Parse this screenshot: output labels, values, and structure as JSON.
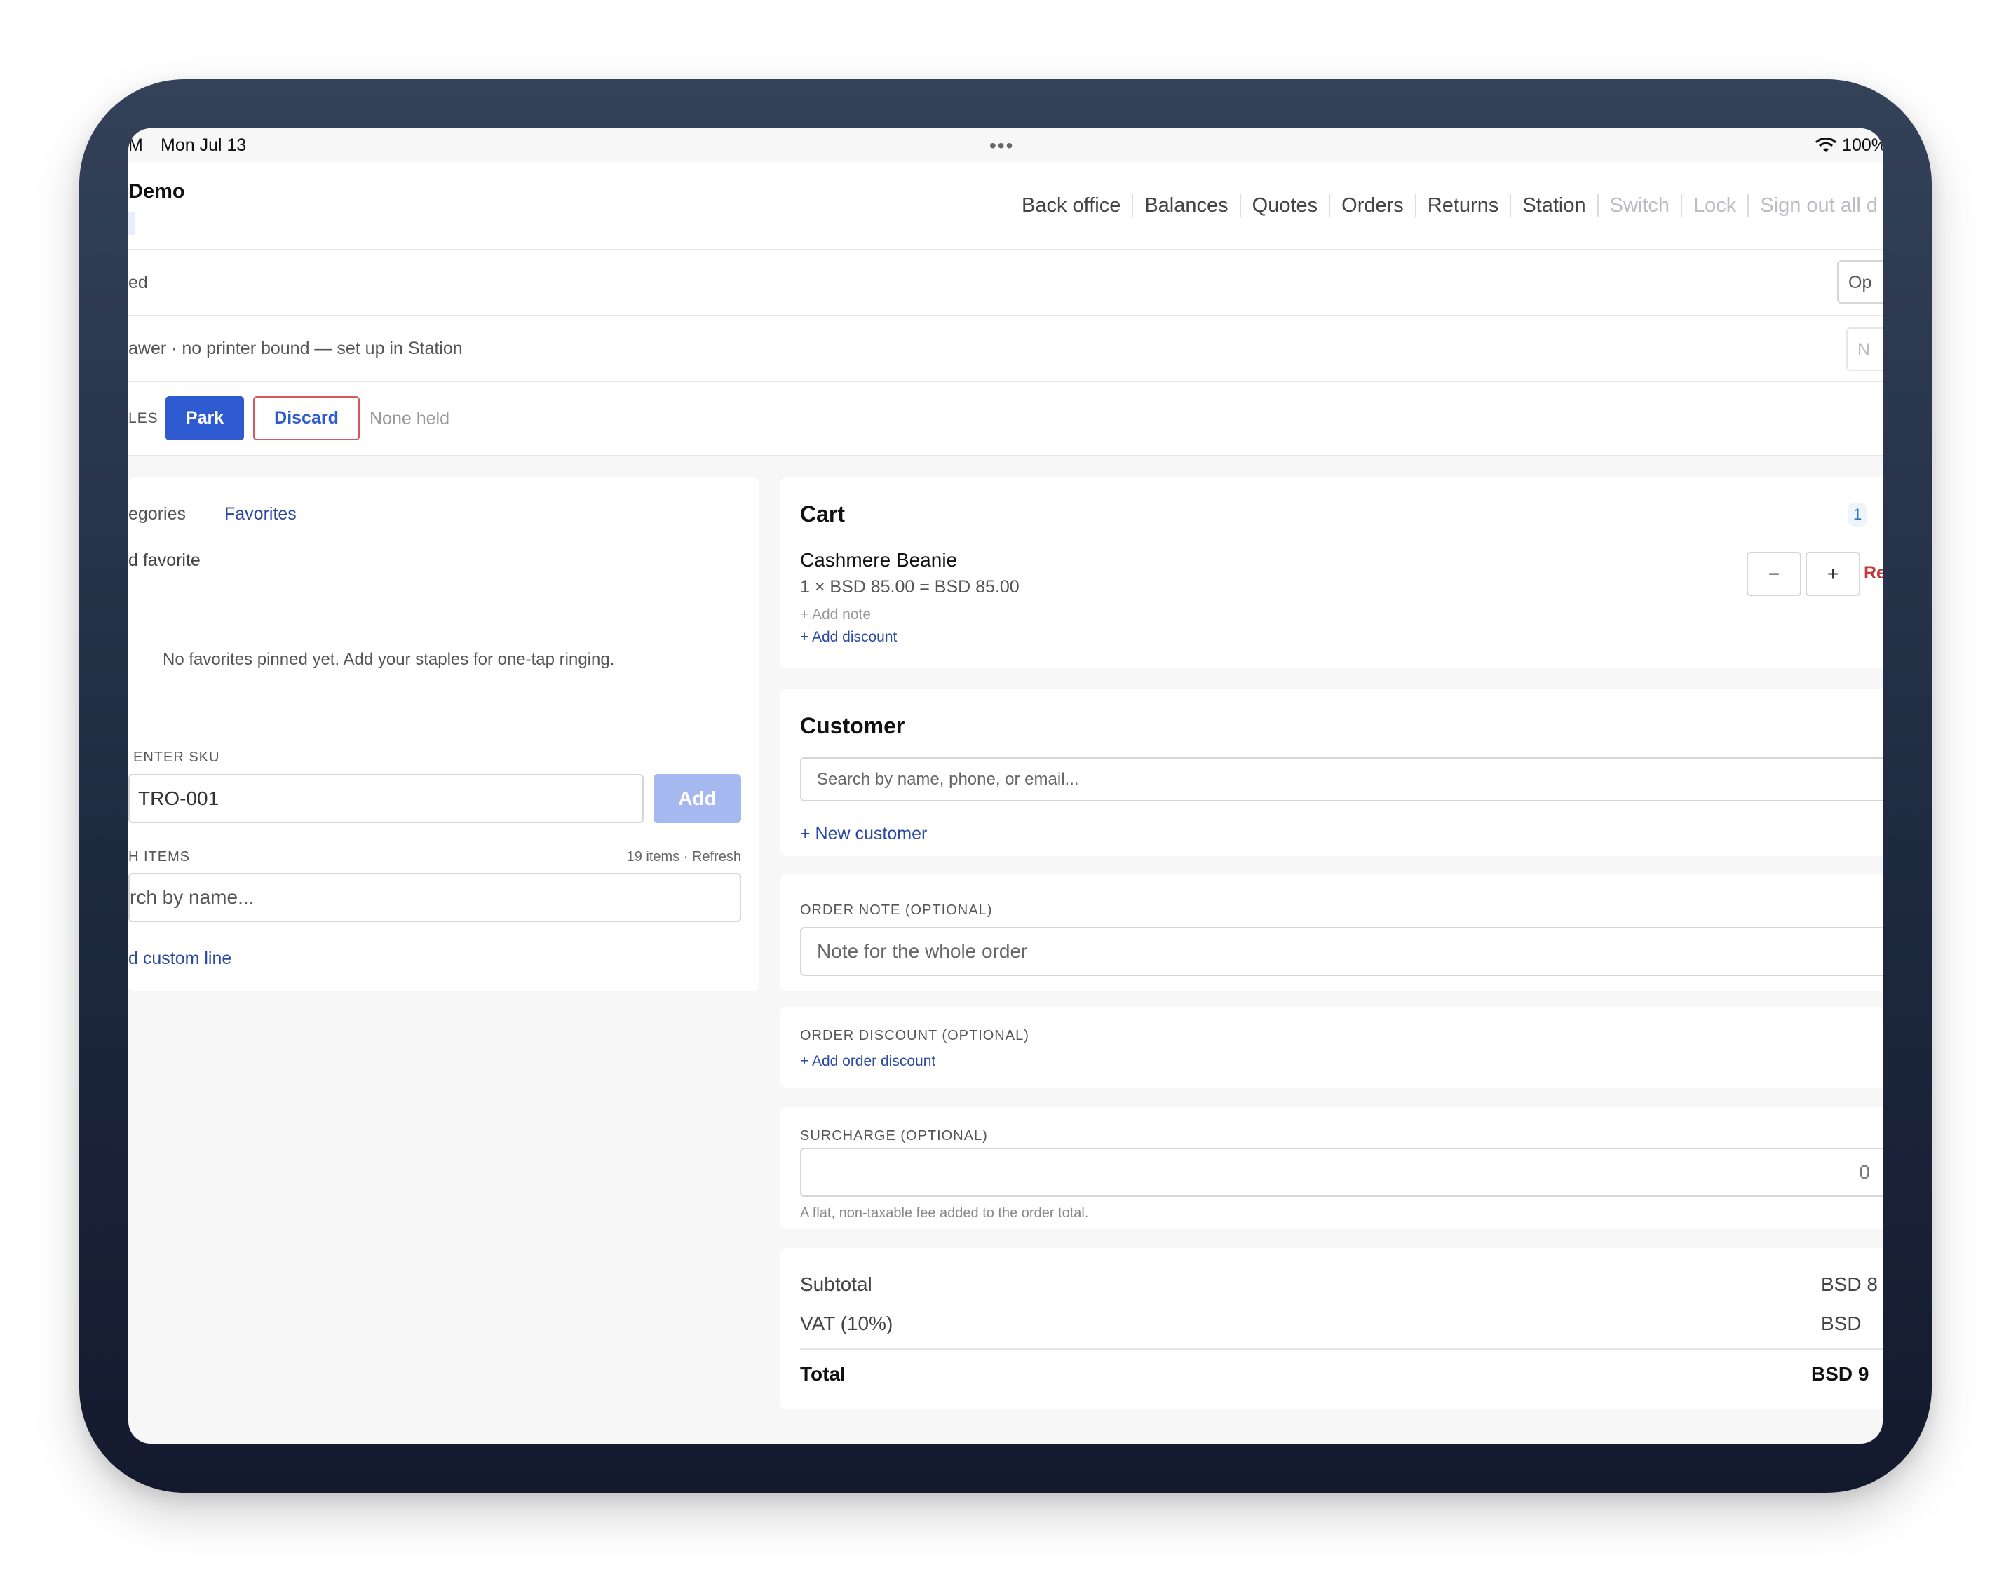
{
  "status_bar": {
    "time": "M",
    "date": "Mon Jul 13",
    "dots": "•••",
    "battery": "100%"
  },
  "header": {
    "brand": "Demo",
    "nav": [
      "Back office",
      "Balances",
      "Quotes",
      "Orders",
      "Returns",
      "Station"
    ],
    "nav_muted": [
      "Switch",
      "Lock",
      "Sign out all d"
    ]
  },
  "shift_row": {
    "text": "ed",
    "button": "Op"
  },
  "drawer_row": {
    "text": "awer · no printer bound — set up in Station",
    "button": "N"
  },
  "sales_row": {
    "label": "LES",
    "park": "Park",
    "discard": "Discard",
    "held": "None held"
  },
  "products": {
    "tab_categories": "egories",
    "tab_favorites": "Favorites",
    "add_favorite": "d favorite",
    "empty": "No favorites pinned yet. Add your staples for one-tap ringing.",
    "sku_label": "ENTER SKU",
    "sku_value": "TRO-001",
    "add_button": "Add",
    "items_label": "H ITEMS",
    "items_count": "19 items · Refresh",
    "search_placeholder": "rch by name...",
    "custom_line": "d custom line"
  },
  "cart": {
    "title": "Cart",
    "count": "1",
    "item_name": "Cashmere Beanie",
    "item_price": "1 × BSD 85.00 = BSD 85.00",
    "add_note": "+ Add note",
    "add_discount": "+ Add discount",
    "minus": "−",
    "plus": "+",
    "remove": "Re"
  },
  "customer": {
    "title": "Customer",
    "search_placeholder": "Search by name, phone, or email...",
    "new_customer": "+ New customer"
  },
  "order_note": {
    "label": "ORDER NOTE (OPTIONAL)",
    "placeholder": "Note for the whole order"
  },
  "order_discount": {
    "label": "ORDER DISCOUNT (OPTIONAL)",
    "add": "+ Add order discount"
  },
  "surcharge": {
    "label": "SURCHARGE (OPTIONAL)",
    "value": "0",
    "help": "A flat, non-taxable fee added to the order total."
  },
  "totals": {
    "subtotal_label": "Subtotal",
    "subtotal_value": "BSD 8",
    "vat_label": "VAT (10%)",
    "vat_value": "BSD",
    "total_label": "Total",
    "total_value": "BSD 9"
  }
}
